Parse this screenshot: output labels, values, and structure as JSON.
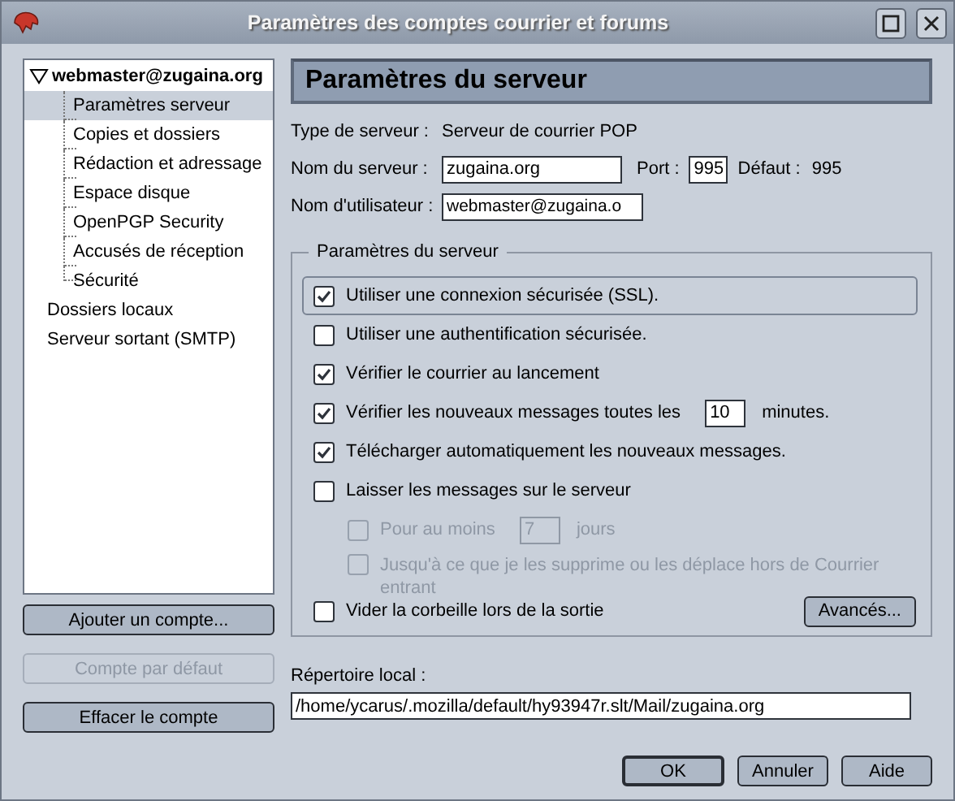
{
  "window": {
    "title": "Paramètres des comptes courrier et forums"
  },
  "tree": [
    {
      "label": "webmaster@zugaina.org",
      "expanded": true,
      "selected": false,
      "children": [
        {
          "label": "Paramètres serveur",
          "selected": true
        },
        {
          "label": "Copies et dossiers",
          "selected": false
        },
        {
          "label": "Rédaction et adressage",
          "selected": false
        },
        {
          "label": "Espace disque",
          "selected": false
        },
        {
          "label": "OpenPGP Security",
          "selected": false
        },
        {
          "label": "Accusés de réception",
          "selected": false
        },
        {
          "label": "Sécurité",
          "selected": false
        }
      ]
    },
    {
      "label": "Dossiers locaux",
      "selected": false
    },
    {
      "label": "Serveur sortant (SMTP)",
      "selected": false
    }
  ],
  "account_buttons": [
    {
      "label": "Ajouter un compte...",
      "disabled": false
    },
    {
      "label": "Compte par défaut",
      "disabled": true
    },
    {
      "label": "Effacer le compte",
      "disabled": false
    }
  ],
  "panel": {
    "heading": "Paramètres du serveur",
    "server_type_label": "Type de serveur :",
    "server_type": "Serveur de courrier POP",
    "server_name_label": "Nom du serveur :",
    "server_name": "zugaina.org",
    "port_label": "Port :",
    "port": "995",
    "default_label": "Défaut :",
    "default_port": "995",
    "username_label": "Nom d'utilisateur :",
    "username": "webmaster@zugaina.o",
    "group_title": "Paramètres du serveur",
    "options": [
      {
        "kind": "checkbox",
        "label": "Utiliser une connexion sécurisée (SSL).",
        "checked": true,
        "disabled": false,
        "focused": true
      },
      {
        "kind": "checkbox",
        "label": "Utiliser une authentification sécurisée.",
        "checked": false,
        "disabled": false,
        "focused": false
      },
      {
        "kind": "checkbox",
        "label": "Vérifier le courrier au lancement",
        "checked": true,
        "disabled": false,
        "focused": false
      },
      {
        "kind": "number",
        "label": "Vérifier les nouveaux messages toutes les",
        "value": "10",
        "suffix": "minutes.",
        "checked": true,
        "disabled": false,
        "focused": false
      },
      {
        "kind": "checkbox",
        "label": "Télécharger automatiquement les nouveaux messages.",
        "checked": true,
        "disabled": false,
        "focused": false
      },
      {
        "kind": "checkbox",
        "label": "Laisser les messages sur le serveur",
        "checked": false,
        "disabled": false,
        "focused": false
      },
      {
        "kind": "sub_number",
        "label": "Pour au moins",
        "value": "7",
        "suffix": "jours",
        "checked": false,
        "disabled": true,
        "focused": false
      },
      {
        "kind": "sub",
        "label": "Jusqu'à ce que je les supprime ou les déplace hors de Courrier entrant",
        "checked": false,
        "disabled": true,
        "focused": false
      }
    ],
    "empty_trash": {
      "label": "Vider la corbeille lors de la sortie",
      "checked": false
    },
    "advanced_button": "Avancés...",
    "local_dir_label": "Répertoire local :",
    "local_dir": "/home/ycarus/.mozilla/default/hy93947r.slt/Mail/zugaina.org"
  },
  "dialog_buttons": [
    {
      "label": "OK",
      "default": true
    },
    {
      "label": "Annuler",
      "default": false
    },
    {
      "label": "Aide",
      "default": false
    }
  ]
}
